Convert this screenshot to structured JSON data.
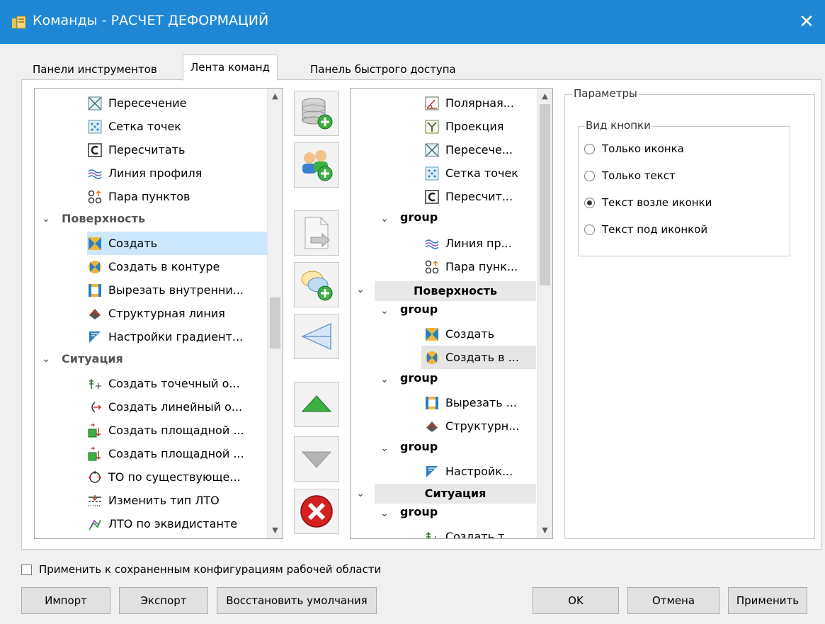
{
  "window": {
    "title": "Команды - РАСЧЕТ ДЕФОРМАЦИЙ",
    "close_glyph": "✕"
  },
  "tabs": [
    "Панели инструментов",
    "Лента команд",
    "Панель быстрого доступа"
  ],
  "active_tab": "Лента команд",
  "left_tree": {
    "items_a": [
      "Пересечение",
      "Сетка точек",
      "Пересчитать",
      "Линия профиля",
      "Пара пунктов"
    ],
    "group_surface": "Поверхность",
    "items_b": [
      "Создать",
      "Создать в контуре",
      "Вырезать внутренни...",
      "Структурная линия",
      "Настройки градиент..."
    ],
    "group_situation": "Ситуация",
    "items_c": [
      "Создать точечный о...",
      "Создать линейный о...",
      "Создать площадной ...",
      "Создать площадной ...",
      "ТО по существующе...",
      "Изменить тип ЛТО",
      "ЛТО по эквидистанте"
    ]
  },
  "mid_buttons": [
    "add-database",
    "add-users",
    "move-right",
    "add-comment",
    "separator",
    "move-up",
    "move-down",
    "delete"
  ],
  "right_tree": {
    "items_a": [
      "Полярная...",
      "Проекция",
      "Пересече...",
      "Сетка точек",
      "Пересчит..."
    ],
    "group_label": "group",
    "items_b": [
      "Линия пр...",
      "Пара пунк..."
    ],
    "header_surface": "Поверхность",
    "items_c": [
      "Создать",
      "Создать в ..."
    ],
    "items_d": [
      "Вырезать ...",
      "Структурн..."
    ],
    "items_e": [
      "Настройк..."
    ],
    "header_situation": "Ситуация",
    "items_f": [
      "Создать т..."
    ]
  },
  "params": {
    "title": "Параметры",
    "view_title": "Вид кнопки",
    "options": [
      "Только иконка",
      "Только текст",
      "Текст возле иконки",
      "Текст под иконкой"
    ],
    "selected": "Текст возле иконки"
  },
  "apply_saved_label": "Применить к сохраненным конфигурациям рабочей области",
  "buttons": {
    "import": "Импорт",
    "export": "Экспорт",
    "restore": "Восстановить умолчания",
    "ok": "OK",
    "cancel": "Отмена",
    "apply": "Применить"
  },
  "colors": {
    "titlebar": "#1f88d6",
    "selection": "#cce8ff",
    "group_text": "#555555"
  }
}
